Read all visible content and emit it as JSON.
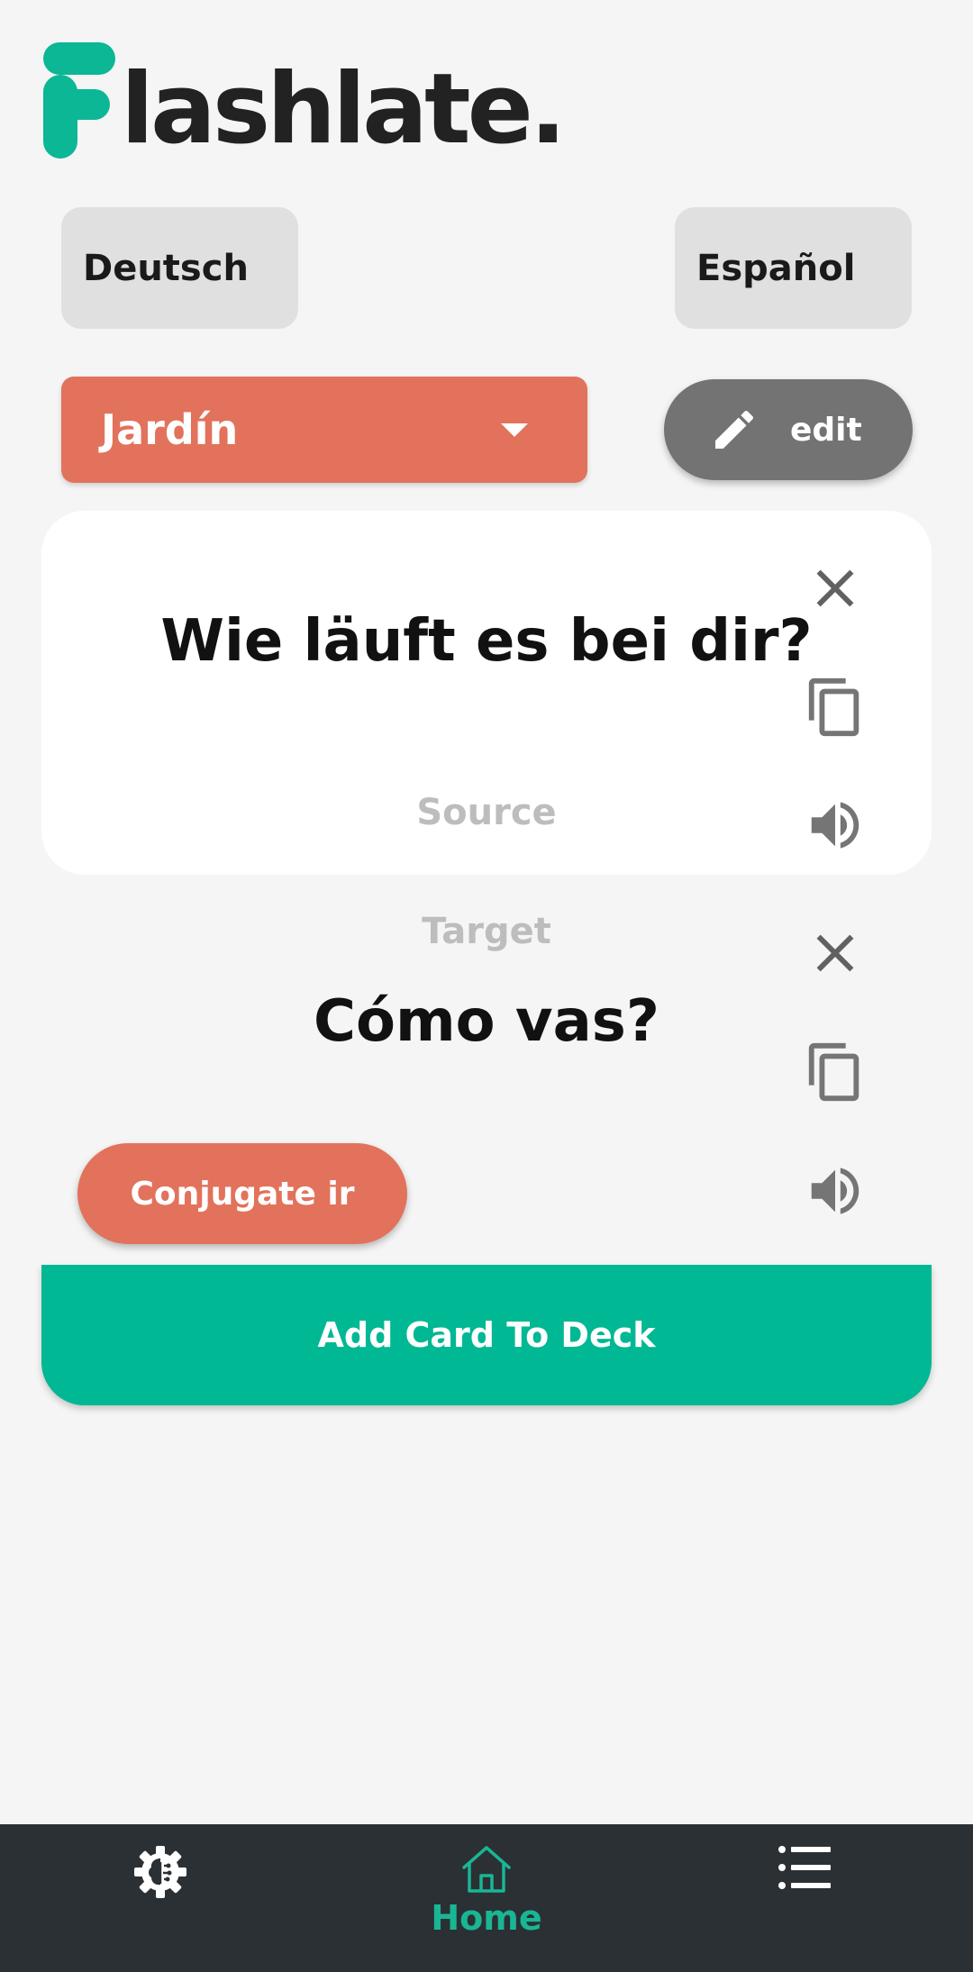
{
  "app": {
    "logo_text": "lashlate."
  },
  "languages": {
    "source": "Deutsch",
    "target": "Español"
  },
  "deck": {
    "selected": "Jardín",
    "edit_label": "edit"
  },
  "source_card": {
    "phrase": "Wie läuft es bei dir?",
    "label": "Source"
  },
  "target_card": {
    "label": "Target",
    "phrase": "Cómo vas?",
    "conjugate_label": "Conjugate ir"
  },
  "actions": {
    "add_card_label": "Add Card To Deck"
  },
  "nav": {
    "items": [
      {
        "icon": "settings-brain-icon",
        "label": ""
      },
      {
        "icon": "home-icon",
        "label": "Home"
      },
      {
        "icon": "list-icon",
        "label": ""
      }
    ]
  },
  "colors": {
    "accent_green": "#00b894",
    "accent_coral": "#e2725b",
    "nav_background": "#2b3035",
    "background": "#f5f5f5"
  }
}
